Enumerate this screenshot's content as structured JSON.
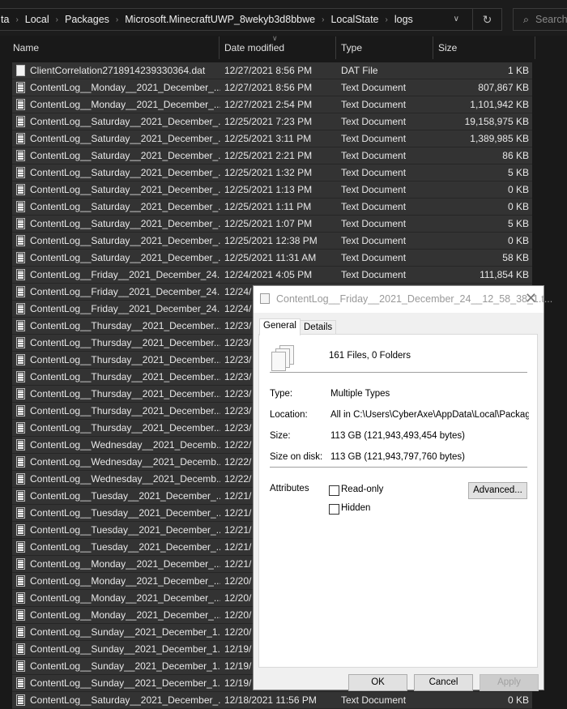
{
  "address_bar": {
    "crumbs": [
      "ta",
      "Local",
      "Packages",
      "Microsoft.MinecraftUWP_8wekyb3d8bbwe",
      "LocalState",
      "logs"
    ],
    "search_placeholder": "Search"
  },
  "columns": {
    "name": "Name",
    "date": "Date modified",
    "type": "Type",
    "size": "Size"
  },
  "files": [
    {
      "name": "ClientCorrelation2718914239330364.dat",
      "date": "12/27/2021 8:56 PM",
      "type": "DAT File",
      "size": "1 KB",
      "icon": "dat"
    },
    {
      "name": "ContentLog__Monday__2021_December_...",
      "date": "12/27/2021 8:56 PM",
      "type": "Text Document",
      "size": "807,867 KB"
    },
    {
      "name": "ContentLog__Monday__2021_December_...",
      "date": "12/27/2021 2:54 PM",
      "type": "Text Document",
      "size": "1,101,942 KB"
    },
    {
      "name": "ContentLog__Saturday__2021_December_...",
      "date": "12/25/2021 7:23 PM",
      "type": "Text Document",
      "size": "19,158,975 KB"
    },
    {
      "name": "ContentLog__Saturday__2021_December_...",
      "date": "12/25/2021 3:11 PM",
      "type": "Text Document",
      "size": "1,389,985 KB"
    },
    {
      "name": "ContentLog__Saturday__2021_December_...",
      "date": "12/25/2021 2:21 PM",
      "type": "Text Document",
      "size": "86 KB"
    },
    {
      "name": "ContentLog__Saturday__2021_December_...",
      "date": "12/25/2021 1:32 PM",
      "type": "Text Document",
      "size": "5 KB"
    },
    {
      "name": "ContentLog__Saturday__2021_December_...",
      "date": "12/25/2021 1:13 PM",
      "type": "Text Document",
      "size": "0 KB"
    },
    {
      "name": "ContentLog__Saturday__2021_December_...",
      "date": "12/25/2021 1:11 PM",
      "type": "Text Document",
      "size": "0 KB"
    },
    {
      "name": "ContentLog__Saturday__2021_December_...",
      "date": "12/25/2021 1:07 PM",
      "type": "Text Document",
      "size": "5 KB"
    },
    {
      "name": "ContentLog__Saturday__2021_December_...",
      "date": "12/25/2021 12:38 PM",
      "type": "Text Document",
      "size": "0 KB"
    },
    {
      "name": "ContentLog__Saturday__2021_December_...",
      "date": "12/25/2021 11:31 AM",
      "type": "Text Document",
      "size": "58 KB"
    },
    {
      "name": "ContentLog__Friday__2021_December_24...",
      "date": "12/24/2021 4:05 PM",
      "type": "Text Document",
      "size": "111,854 KB"
    },
    {
      "name": "ContentLog__Friday__2021_December_24...",
      "date": "12/24/"
    },
    {
      "name": "ContentLog__Friday__2021_December_24...",
      "date": "12/24/"
    },
    {
      "name": "ContentLog__Thursday__2021_December...",
      "date": "12/23/"
    },
    {
      "name": "ContentLog__Thursday__2021_December...",
      "date": "12/23/"
    },
    {
      "name": "ContentLog__Thursday__2021_December...",
      "date": "12/23/"
    },
    {
      "name": "ContentLog__Thursday__2021_December...",
      "date": "12/23/"
    },
    {
      "name": "ContentLog__Thursday__2021_December...",
      "date": "12/23/"
    },
    {
      "name": "ContentLog__Thursday__2021_December...",
      "date": "12/23/"
    },
    {
      "name": "ContentLog__Thursday__2021_December...",
      "date": "12/23/"
    },
    {
      "name": "ContentLog__Wednesday__2021_Decemb...",
      "date": "12/22/"
    },
    {
      "name": "ContentLog__Wednesday__2021_Decemb...",
      "date": "12/22/"
    },
    {
      "name": "ContentLog__Wednesday__2021_Decemb...",
      "date": "12/22/"
    },
    {
      "name": "ContentLog__Tuesday__2021_December_...",
      "date": "12/21/"
    },
    {
      "name": "ContentLog__Tuesday__2021_December_...",
      "date": "12/21/"
    },
    {
      "name": "ContentLog__Tuesday__2021_December_...",
      "date": "12/21/"
    },
    {
      "name": "ContentLog__Tuesday__2021_December_...",
      "date": "12/21/"
    },
    {
      "name": "ContentLog__Monday__2021_December_...",
      "date": "12/21/"
    },
    {
      "name": "ContentLog__Monday__2021_December_...",
      "date": "12/20/"
    },
    {
      "name": "ContentLog__Monday__2021_December_...",
      "date": "12/20/"
    },
    {
      "name": "ContentLog__Monday__2021_December_...",
      "date": "12/20/"
    },
    {
      "name": "ContentLog__Sunday__2021_December_1...",
      "date": "12/20/"
    },
    {
      "name": "ContentLog__Sunday__2021_December_1...",
      "date": "12/19/"
    },
    {
      "name": "ContentLog__Sunday__2021_December_1...",
      "date": "12/19/"
    },
    {
      "name": "ContentLog__Sunday__2021_December_1...",
      "date": "12/19/"
    },
    {
      "name": "ContentLog__Saturday__2021_December_...",
      "date": "12/18/2021 11:56 PM",
      "type": "Text Document",
      "size": "0 KB"
    }
  ],
  "dialog": {
    "title": "ContentLog__Friday__2021_December_24__12_58_38_1.t...",
    "tabs": [
      "General",
      "Details"
    ],
    "summary": "161 Files, 0 Folders",
    "type_label": "Type:",
    "type_value": "Multiple Types",
    "location_label": "Location:",
    "location_value": "All in C:\\Users\\CyberAxe\\AppData\\Local\\Packages\\",
    "size_label": "Size:",
    "size_value": "113 GB (121,943,493,454 bytes)",
    "disk_label": "Size on disk:",
    "disk_value": "113 GB (121,943,797,760 bytes)",
    "attributes_label": "Attributes",
    "readonly_label": "Read-only",
    "readonly_checked": false,
    "hidden_label": "Hidden",
    "hidden_checked": false,
    "advanced_label": "Advanced...",
    "ok_label": "OK",
    "cancel_label": "Cancel",
    "apply_label": "Apply"
  }
}
